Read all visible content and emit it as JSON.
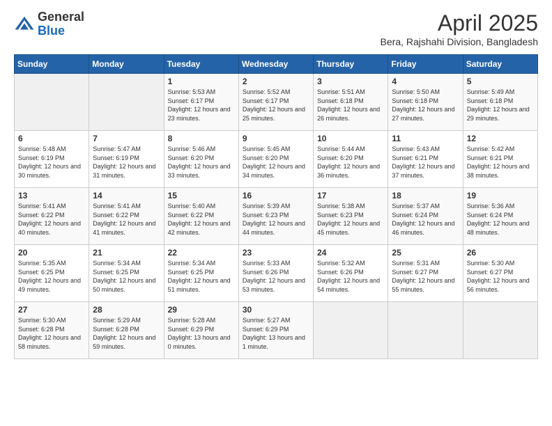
{
  "logo": {
    "general": "General",
    "blue": "Blue"
  },
  "title": "April 2025",
  "subtitle": "Bera, Rajshahi Division, Bangladesh",
  "weekdays": [
    "Sunday",
    "Monday",
    "Tuesday",
    "Wednesday",
    "Thursday",
    "Friday",
    "Saturday"
  ],
  "weeks": [
    [
      {
        "day": "",
        "info": ""
      },
      {
        "day": "",
        "info": ""
      },
      {
        "day": "1",
        "info": "Sunrise: 5:53 AM\nSunset: 6:17 PM\nDaylight: 12 hours and 23 minutes."
      },
      {
        "day": "2",
        "info": "Sunrise: 5:52 AM\nSunset: 6:17 PM\nDaylight: 12 hours and 25 minutes."
      },
      {
        "day": "3",
        "info": "Sunrise: 5:51 AM\nSunset: 6:18 PM\nDaylight: 12 hours and 26 minutes."
      },
      {
        "day": "4",
        "info": "Sunrise: 5:50 AM\nSunset: 6:18 PM\nDaylight: 12 hours and 27 minutes."
      },
      {
        "day": "5",
        "info": "Sunrise: 5:49 AM\nSunset: 6:18 PM\nDaylight: 12 hours and 29 minutes."
      }
    ],
    [
      {
        "day": "6",
        "info": "Sunrise: 5:48 AM\nSunset: 6:19 PM\nDaylight: 12 hours and 30 minutes."
      },
      {
        "day": "7",
        "info": "Sunrise: 5:47 AM\nSunset: 6:19 PM\nDaylight: 12 hours and 31 minutes."
      },
      {
        "day": "8",
        "info": "Sunrise: 5:46 AM\nSunset: 6:20 PM\nDaylight: 12 hours and 33 minutes."
      },
      {
        "day": "9",
        "info": "Sunrise: 5:45 AM\nSunset: 6:20 PM\nDaylight: 12 hours and 34 minutes."
      },
      {
        "day": "10",
        "info": "Sunrise: 5:44 AM\nSunset: 6:20 PM\nDaylight: 12 hours and 36 minutes."
      },
      {
        "day": "11",
        "info": "Sunrise: 5:43 AM\nSunset: 6:21 PM\nDaylight: 12 hours and 37 minutes."
      },
      {
        "day": "12",
        "info": "Sunrise: 5:42 AM\nSunset: 6:21 PM\nDaylight: 12 hours and 38 minutes."
      }
    ],
    [
      {
        "day": "13",
        "info": "Sunrise: 5:41 AM\nSunset: 6:22 PM\nDaylight: 12 hours and 40 minutes."
      },
      {
        "day": "14",
        "info": "Sunrise: 5:41 AM\nSunset: 6:22 PM\nDaylight: 12 hours and 41 minutes."
      },
      {
        "day": "15",
        "info": "Sunrise: 5:40 AM\nSunset: 6:22 PM\nDaylight: 12 hours and 42 minutes."
      },
      {
        "day": "16",
        "info": "Sunrise: 5:39 AM\nSunset: 6:23 PM\nDaylight: 12 hours and 44 minutes."
      },
      {
        "day": "17",
        "info": "Sunrise: 5:38 AM\nSunset: 6:23 PM\nDaylight: 12 hours and 45 minutes."
      },
      {
        "day": "18",
        "info": "Sunrise: 5:37 AM\nSunset: 6:24 PM\nDaylight: 12 hours and 46 minutes."
      },
      {
        "day": "19",
        "info": "Sunrise: 5:36 AM\nSunset: 6:24 PM\nDaylight: 12 hours and 48 minutes."
      }
    ],
    [
      {
        "day": "20",
        "info": "Sunrise: 5:35 AM\nSunset: 6:25 PM\nDaylight: 12 hours and 49 minutes."
      },
      {
        "day": "21",
        "info": "Sunrise: 5:34 AM\nSunset: 6:25 PM\nDaylight: 12 hours and 50 minutes."
      },
      {
        "day": "22",
        "info": "Sunrise: 5:34 AM\nSunset: 6:25 PM\nDaylight: 12 hours and 51 minutes."
      },
      {
        "day": "23",
        "info": "Sunrise: 5:33 AM\nSunset: 6:26 PM\nDaylight: 12 hours and 53 minutes."
      },
      {
        "day": "24",
        "info": "Sunrise: 5:32 AM\nSunset: 6:26 PM\nDaylight: 12 hours and 54 minutes."
      },
      {
        "day": "25",
        "info": "Sunrise: 5:31 AM\nSunset: 6:27 PM\nDaylight: 12 hours and 55 minutes."
      },
      {
        "day": "26",
        "info": "Sunrise: 5:30 AM\nSunset: 6:27 PM\nDaylight: 12 hours and 56 minutes."
      }
    ],
    [
      {
        "day": "27",
        "info": "Sunrise: 5:30 AM\nSunset: 6:28 PM\nDaylight: 12 hours and 58 minutes."
      },
      {
        "day": "28",
        "info": "Sunrise: 5:29 AM\nSunset: 6:28 PM\nDaylight: 12 hours and 59 minutes."
      },
      {
        "day": "29",
        "info": "Sunrise: 5:28 AM\nSunset: 6:29 PM\nDaylight: 13 hours and 0 minutes."
      },
      {
        "day": "30",
        "info": "Sunrise: 5:27 AM\nSunset: 6:29 PM\nDaylight: 13 hours and 1 minute."
      },
      {
        "day": "",
        "info": ""
      },
      {
        "day": "",
        "info": ""
      },
      {
        "day": "",
        "info": ""
      }
    ]
  ]
}
